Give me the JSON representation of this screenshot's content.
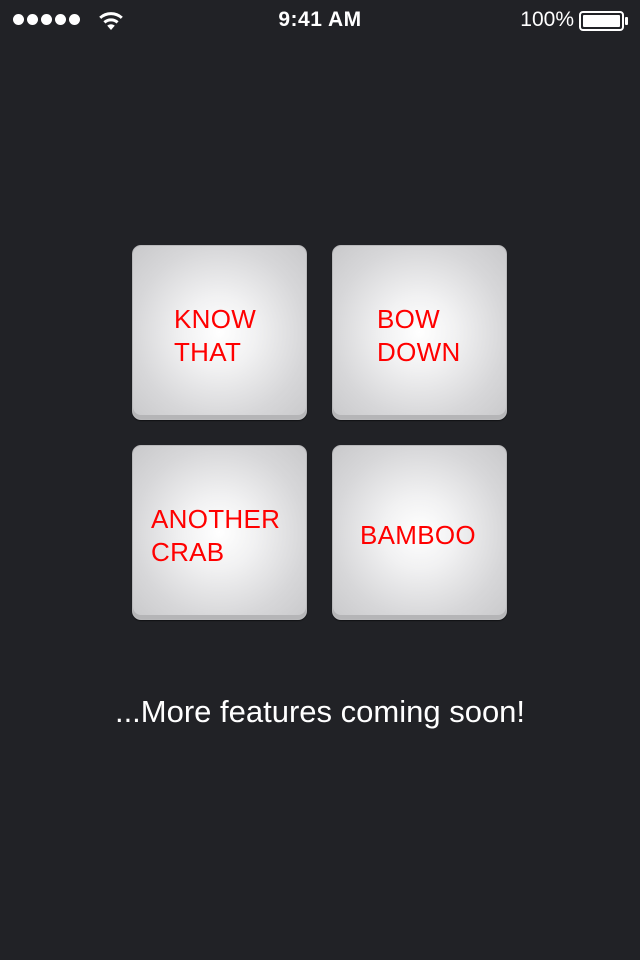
{
  "status_bar": {
    "time": "9:41 AM",
    "battery_percent": "100%",
    "signal_bars": 5,
    "battery_level": 1.0
  },
  "tiles": [
    {
      "label": "KNOW\nTHAT"
    },
    {
      "label": "BOW\nDOWN"
    },
    {
      "label": "ANOTHER\nCRAB"
    },
    {
      "label": "BAMBOO"
    }
  ],
  "footer": {
    "message": "...More features coming soon!"
  },
  "colors": {
    "background": "#212226",
    "tile_text": "#ff0000",
    "tile_face": "#e8e8ea"
  },
  "icons": {
    "signal": "signal-dots-icon",
    "wifi": "wifi-icon",
    "battery": "battery-icon"
  }
}
